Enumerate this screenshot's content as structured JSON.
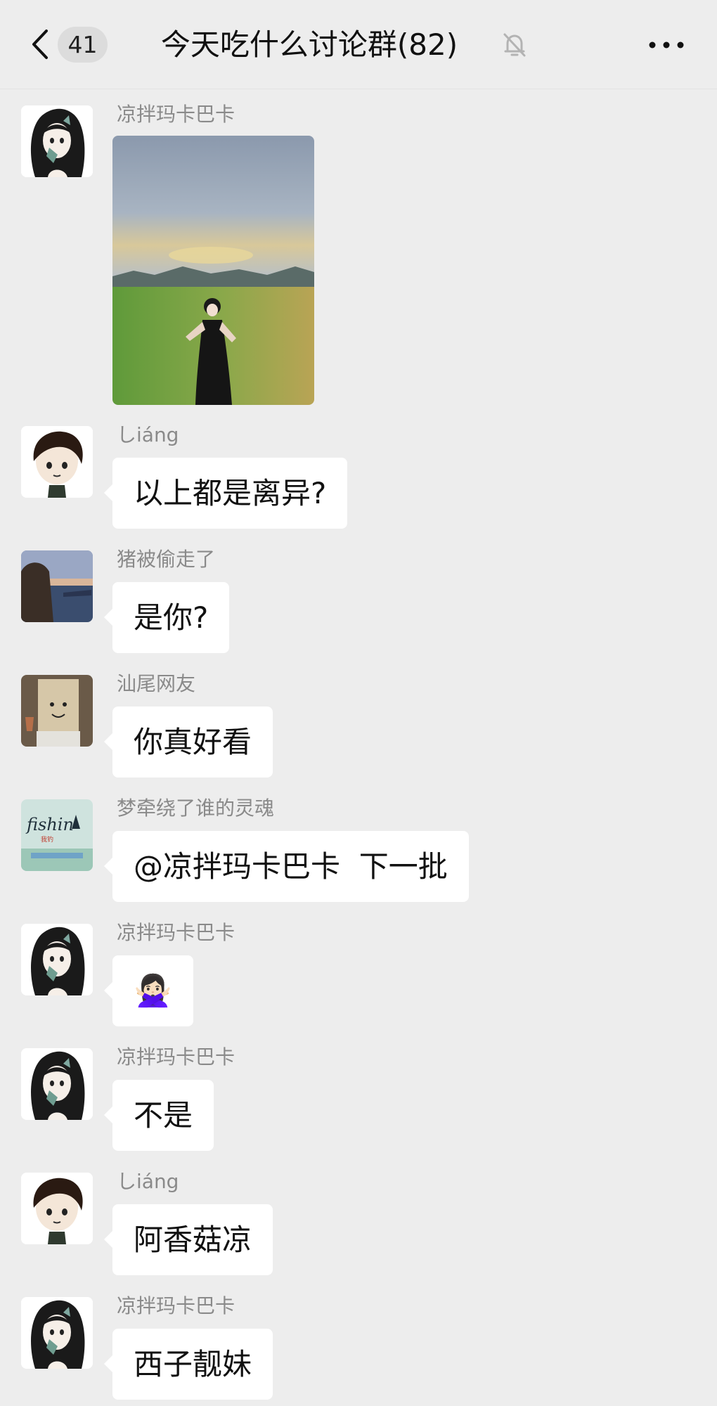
{
  "header": {
    "back_icon": "chevron-left-icon",
    "unread_count": "41",
    "title": "今天吃什么讨论群(82)",
    "mute_icon": "bell-off-icon",
    "more_icon": "ellipsis-icon"
  },
  "messages": [
    {
      "sender": "凉拌玛卡巴卡",
      "type": "image",
      "avatar_icon": "anime-girl-avatar",
      "image_icon": "photo-girl-in-field"
    },
    {
      "sender": "しiáng",
      "type": "text",
      "text": "以上都是离异?",
      "avatar_icon": "cartoon-boy-avatar"
    },
    {
      "sender": "猪被偷走了",
      "type": "text",
      "text": "是你?",
      "avatar_icon": "hooded-person-seaside-avatar"
    },
    {
      "sender": "汕尾网友",
      "type": "text",
      "text": "你真好看",
      "avatar_icon": "paper-bag-face-avatar"
    },
    {
      "sender": "梦牵绕了谁的灵魂",
      "type": "text",
      "text": "@凉拌玛卡巴卡  下一批",
      "avatar_icon": "fishing-logo-avatar"
    },
    {
      "sender": "凉拌玛卡巴卡",
      "type": "emoji",
      "text": "🙅🏻‍♀️",
      "avatar_icon": "anime-girl-avatar"
    },
    {
      "sender": "凉拌玛卡巴卡",
      "type": "text",
      "text": "不是",
      "avatar_icon": "anime-girl-avatar"
    },
    {
      "sender": "しiáng",
      "type": "text",
      "text": "阿香菇凉",
      "avatar_icon": "cartoon-boy-avatar"
    },
    {
      "sender": "凉拌玛卡巴卡",
      "type": "text",
      "text": "西子靓妹",
      "avatar_icon": "anime-girl-avatar"
    }
  ],
  "colors": {
    "background": "#ededed",
    "bubble": "#ffffff",
    "sender_name": "#8a8a8a",
    "text": "#111111"
  }
}
